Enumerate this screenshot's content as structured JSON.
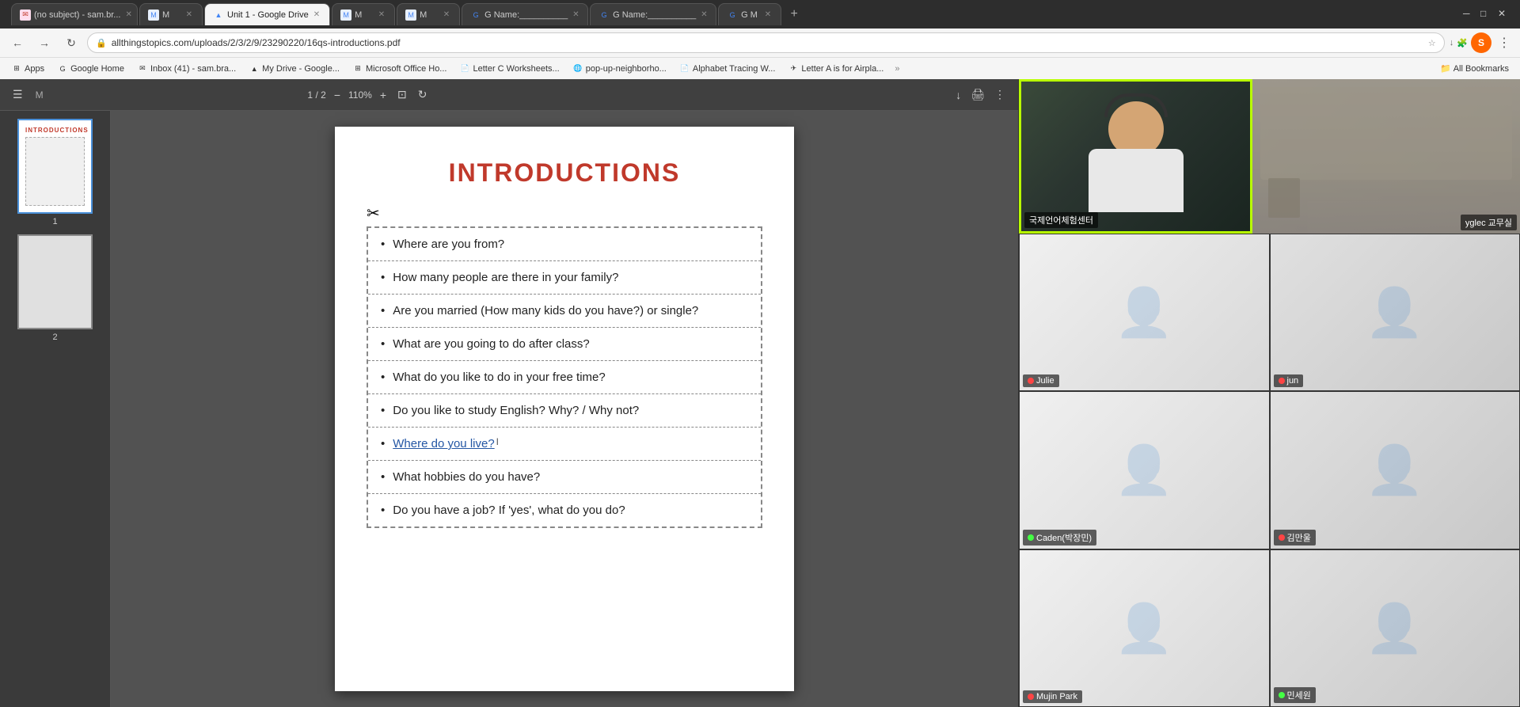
{
  "browser": {
    "tabs": [
      {
        "id": "tab1",
        "label": "(no subject) - sam.br...",
        "favicon": "M",
        "favicon_color": "#c0392b",
        "active": false
      },
      {
        "id": "tab2",
        "label": "M",
        "favicon": "M",
        "favicon_color": "#4285f4",
        "active": false
      },
      {
        "id": "tab3",
        "label": "Unit 1 - Google Drive",
        "favicon": "▲",
        "favicon_color": "#4285f4",
        "active": true
      },
      {
        "id": "tab4",
        "label": "M",
        "favicon": "M",
        "favicon_color": "#4285f4",
        "active": false
      },
      {
        "id": "tab5",
        "label": "M",
        "favicon": "M",
        "favicon_color": "#4285f4",
        "active": false
      },
      {
        "id": "tab6",
        "label": "G Name:__________",
        "favicon": "G",
        "favicon_color": "#4285f4",
        "active": false
      },
      {
        "id": "tab7",
        "label": "G Name:__________",
        "favicon": "G",
        "favicon_color": "#4285f4",
        "active": false
      },
      {
        "id": "tab8",
        "label": "G M",
        "favicon": "G",
        "favicon_color": "#4285f4",
        "active": false
      }
    ],
    "address": "allthingstopics.com/uploads/2/3/2/9/23290220/16qs-introductions.pdf",
    "bookmarks": [
      {
        "label": "Apps",
        "favicon": "☰"
      },
      {
        "label": "Google Home",
        "favicon": "G"
      },
      {
        "label": "Inbox (41) - sam.bra...",
        "favicon": "✉"
      },
      {
        "label": "My Drive - Google...",
        "favicon": "▲"
      },
      {
        "label": "Microsoft Office Ho...",
        "favicon": "⊞"
      },
      {
        "label": "Letter C Worksheets...",
        "favicon": "📄"
      },
      {
        "label": "pop-up-neighborho...",
        "favicon": "🌐"
      },
      {
        "label": "Alphabet Tracing W...",
        "favicon": "📄"
      },
      {
        "label": "Letter A is for Airpla...",
        "favicon": "✈"
      },
      {
        "label": "All Bookmarks",
        "favicon": "☆"
      }
    ]
  },
  "pdf": {
    "current_page": "1",
    "total_pages": "2",
    "zoom": "110%",
    "title": "INTRODUCTIONS",
    "questions": [
      {
        "text": "Where are you from?",
        "highlighted": false
      },
      {
        "text": "How many people are there in your family?",
        "highlighted": false
      },
      {
        "text": "Are you married (How many kids do you have?) or single?",
        "highlighted": false
      },
      {
        "text": "What are you going to do after class?",
        "highlighted": false
      },
      {
        "text": "What do you like to do in your free time?",
        "highlighted": false
      },
      {
        "text": "Do you like to study English?  Why? / Why not?",
        "highlighted": false
      },
      {
        "text": "Where do you live?",
        "highlighted": true
      },
      {
        "text": "What hobbies do you have?",
        "highlighted": false
      },
      {
        "text": "Do you have a job?  If 'yes', what do you do?",
        "highlighted": false
      }
    ]
  },
  "video_panel": {
    "main_speaker": {
      "label": "국제언어체험센터",
      "has_border": true
    },
    "room_preview": {
      "label": "yglec 교무실"
    },
    "participants": [
      {
        "name": "Julie",
        "mic_muted": true,
        "has_video": false
      },
      {
        "name": "jun",
        "mic_muted": true,
        "has_video": false
      },
      {
        "name": "Caden(박장민)",
        "mic_muted": false,
        "has_video": false
      },
      {
        "name": "김만울",
        "mic_muted": true,
        "has_video": false
      },
      {
        "name": "Mujin Park",
        "mic_muted": true,
        "has_video": false
      },
      {
        "name": "민세원",
        "mic_muted": false,
        "has_video": false
      }
    ]
  },
  "toolbar": {
    "menu_icon": "☰",
    "app_label": "M"
  }
}
